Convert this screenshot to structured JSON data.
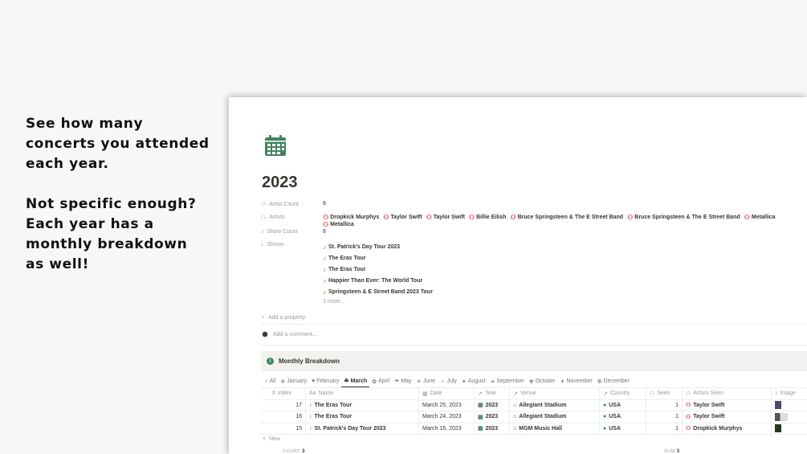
{
  "promo": {
    "paragraph1": "See how many\nconcerts you attended\neach year.",
    "paragraph2": "Not specific enough?\nEach year has a\nmonthly breakdown\nas well!"
  },
  "page": {
    "icon": "calendar-icon",
    "title": "2023",
    "properties": {
      "artist_count_label": "Artist Count",
      "artist_count_value": "8",
      "artists_label": "Artists",
      "artists": [
        "Dropkick Murphys",
        "Taylor Swift",
        "Taylor Swift",
        "Billie Eilish",
        "Bruce Springsteen & The E Street Band",
        "Bruce Springsteen & The E Street Band",
        "Metallica",
        "Metallica"
      ],
      "show_count_label": "Show Count",
      "show_count_value": "8",
      "shows_label": "Shows",
      "shows": [
        "St. Patrick's Day Tour 2023",
        "The Eras Tour",
        "The Eras Tour",
        "Happier Than Ever: The World Tour",
        "Springsteen & E Street Band 2023 Tour"
      ],
      "more_label": "3 more...",
      "add_property_label": "Add a property"
    },
    "comment_placeholder": "Add a comment...",
    "callout_title": "Monthly Breakdown",
    "tabs": [
      "All",
      "January",
      "February",
      "March",
      "April",
      "May",
      "June",
      "July",
      "August",
      "September",
      "October",
      "November",
      "December"
    ],
    "active_tab": "March",
    "table": {
      "headers": {
        "index": "Index",
        "name": "Name",
        "date": "Date",
        "year": "Year",
        "venue": "Venue",
        "country": "Country",
        "seen": "Seen",
        "artists_seen": "Artists Seen",
        "image": "Image"
      },
      "rows": [
        {
          "index": "17",
          "name": "The Eras Tour",
          "date": "March 25, 2023",
          "year": "2023",
          "venue": "Allegiant Stadium",
          "country": "USA",
          "seen": "1",
          "artist": "Taylor Swift"
        },
        {
          "index": "16",
          "name": "The Eras Tour",
          "date": "March 24, 2023",
          "year": "2023",
          "venue": "Allegiant Stadium",
          "country": "USA",
          "seen": "1",
          "artist": "Taylor Swift"
        },
        {
          "index": "15",
          "name": "St. Patrick's Day Tour 2023",
          "date": "March 16, 2023",
          "year": "2023",
          "venue": "MGM Music Hall",
          "country": "USA",
          "seen": "1",
          "artist": "Dropkick Murphys"
        }
      ],
      "new_label": "New",
      "count_label": "COUNT",
      "count_value": "3",
      "sum_label": "SUM",
      "sum_value": "3"
    }
  },
  "colors": {
    "calendar_green": "#448361",
    "artist_red": "#e03e3e",
    "show_orange": "#d9730d"
  }
}
